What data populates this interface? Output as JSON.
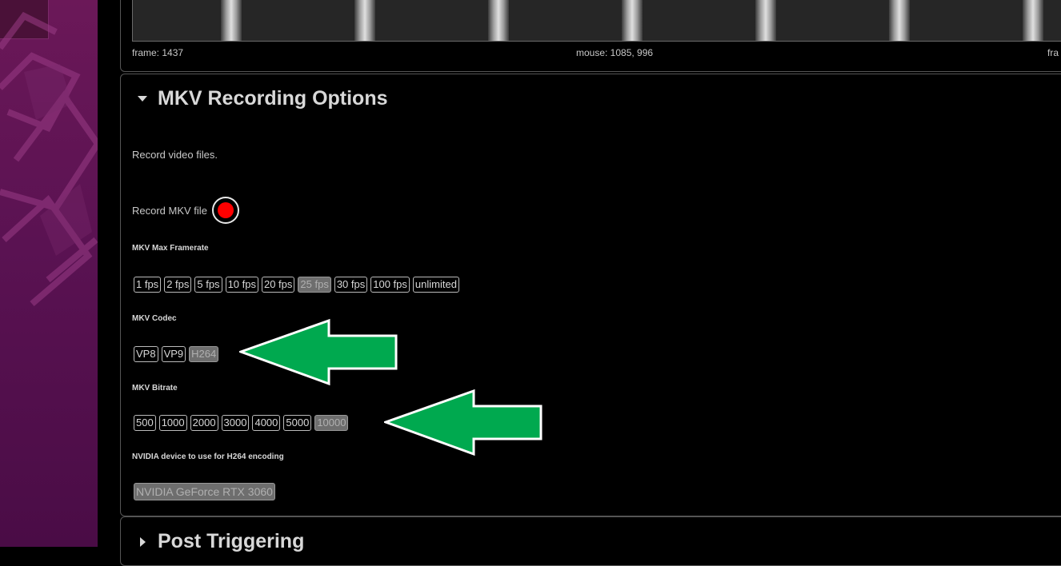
{
  "camera_view": {
    "frame_label": "frame: 1437",
    "mouse_label": "mouse: 1085, 996",
    "right_label": "fra"
  },
  "mkv_section": {
    "title": "MKV Recording Options",
    "description": "Record video files.",
    "record_label": "Record MKV file",
    "record_state_color": "#ff0000",
    "framerate": {
      "label": "MKV Max Framerate",
      "options": [
        "1 fps",
        "2 fps",
        "5 fps",
        "10 fps",
        "20 fps",
        "25 fps",
        "30 fps",
        "100 fps",
        "unlimited"
      ],
      "selected": "25 fps"
    },
    "codec": {
      "label": "MKV Codec",
      "options": [
        "VP8",
        "VP9",
        "H264"
      ],
      "selected": "H264"
    },
    "bitrate": {
      "label": "MKV Bitrate",
      "options": [
        "500",
        "1000",
        "2000",
        "3000",
        "4000",
        "5000",
        "10000"
      ],
      "selected": "10000"
    },
    "nvidia": {
      "label": "NVIDIA device to use for H264 encoding",
      "options": [
        "NVIDIA GeForce RTX 3060"
      ],
      "selected": "NVIDIA GeForce RTX 3060"
    }
  },
  "post_section": {
    "title": "Post Triggering"
  },
  "colors": {
    "page_background": "#000000",
    "sidebar_gradient": "#5a1252",
    "annotation_arrow": "#00a94f",
    "selected_option": "#6e6e6e"
  },
  "icons": {
    "expanded": "triangle-down-icon",
    "collapsed": "triangle-right-icon",
    "record": "record-dot-icon",
    "annotation": "green-arrow-icon"
  }
}
